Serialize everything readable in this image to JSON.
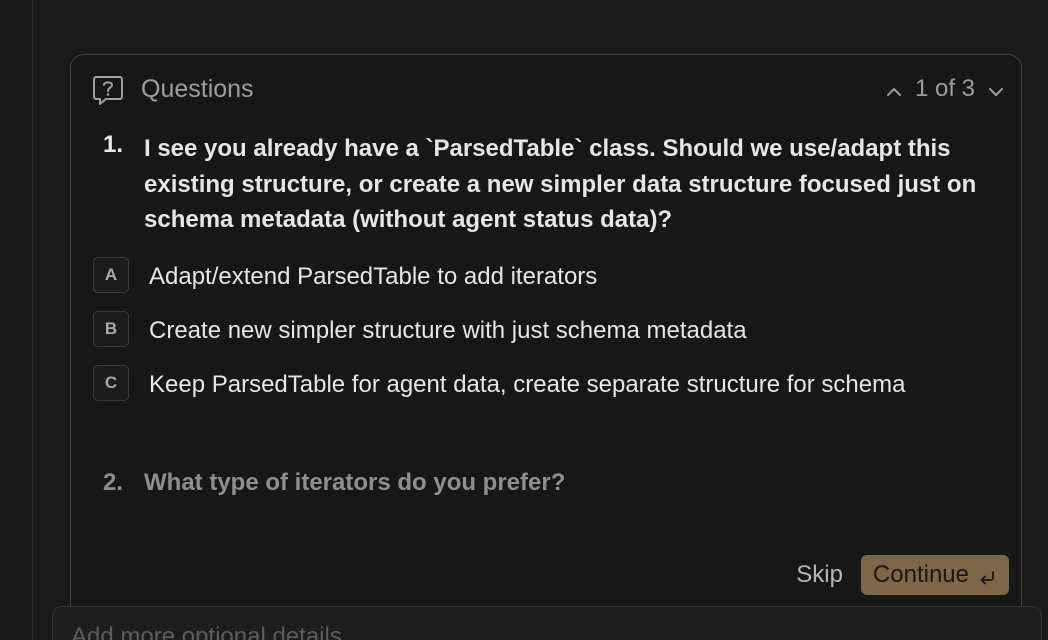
{
  "header": {
    "title": "Questions",
    "icon": "question-bubble-icon",
    "pager": {
      "current": 1,
      "total": 3,
      "label": "1 of 3"
    }
  },
  "question": {
    "number": "1.",
    "text": "I see you already have a `ParsedTable` class. Should we use/adapt this existing structure, or create a new simpler data structure focused just on schema metadata (without agent status data)?",
    "options": [
      {
        "key": "A",
        "text": "Adapt/extend ParsedTable to add iterators"
      },
      {
        "key": "B",
        "text": "Create new simpler structure with just schema metadata"
      },
      {
        "key": "C",
        "text": "Keep ParsedTable for agent data, create separate structure for schema"
      }
    ]
  },
  "next_question": {
    "number": "2.",
    "text": "What type of iterators do you prefer?"
  },
  "footer": {
    "skip_label": "Skip",
    "continue_label": "Continue"
  },
  "details_input": {
    "placeholder": "Add more optional details"
  },
  "colors": {
    "accent": "#7c6849",
    "panel_border": "#4a4436",
    "background": "#1a1a1a"
  }
}
